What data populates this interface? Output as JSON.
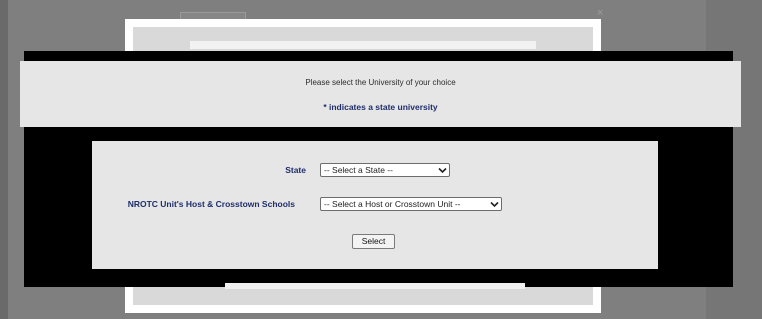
{
  "info": {
    "prompt": "Please select the University of your choice",
    "note": "* indicates a state university"
  },
  "form": {
    "state_label": "State",
    "state_select_value": "-- Select a State --",
    "unit_label": "NROTC Unit's Host & Crosstown Schools",
    "unit_select_value": "-- Select a Host or Crosstown Unit --",
    "submit_label": "Select"
  },
  "icons": {
    "dropdown": "chevron-down-icon",
    "close": "close-icon"
  },
  "colors": {
    "label_text": "#1f2d6b",
    "panel_bg": "#e6e6e6",
    "overlay": "#000000"
  }
}
